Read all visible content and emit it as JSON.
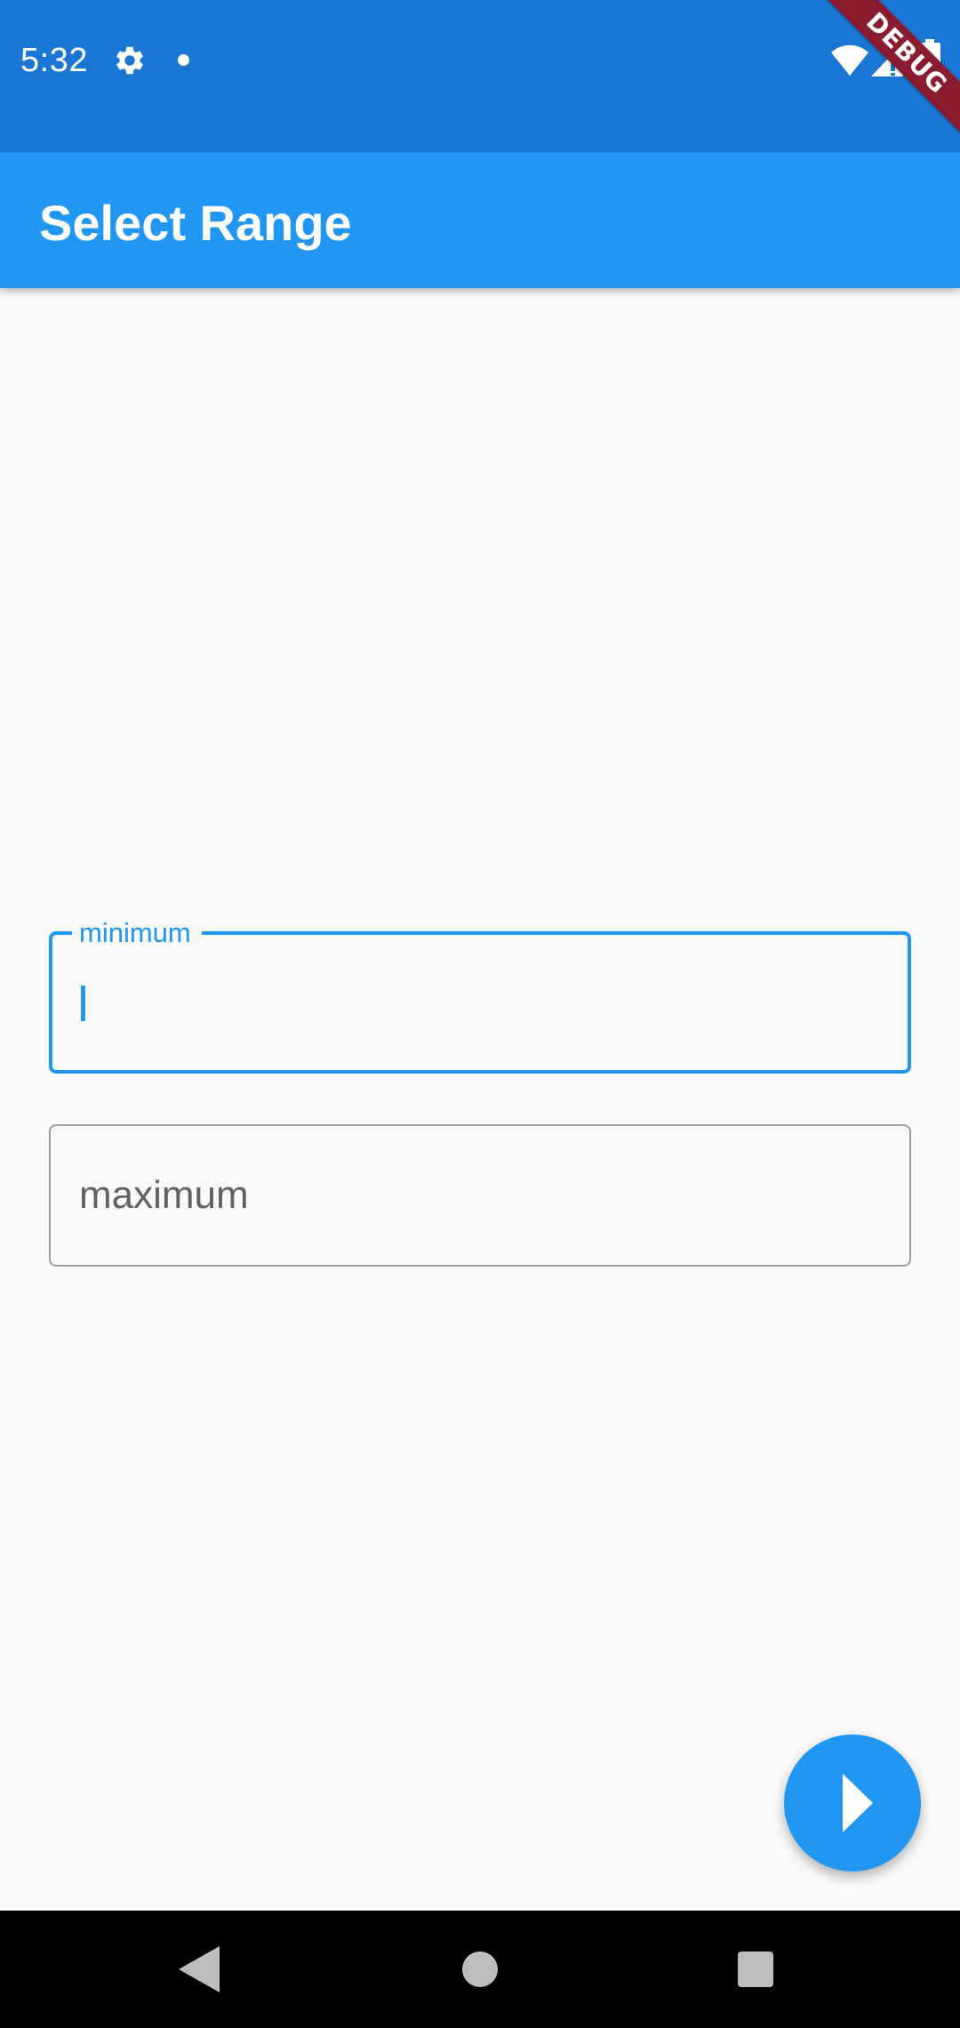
{
  "status_bar": {
    "time": "5:32",
    "icons": [
      "gear-icon",
      "notification-dot-icon",
      "wifi-icon",
      "signal-icon",
      "battery-icon"
    ],
    "color": "#1976d2"
  },
  "debug_banner": {
    "label": "DEBUG",
    "color": "#8b1c30"
  },
  "app_bar": {
    "title": "Select Range",
    "color": "#2196f3"
  },
  "form": {
    "minimum": {
      "label": "minimum",
      "value": "",
      "focused": true,
      "accent_color": "#2196f3"
    },
    "maximum": {
      "placeholder": "maximum",
      "value": "",
      "focused": false,
      "border_color": "#9e9e9e"
    }
  },
  "fab": {
    "icon": "play-arrow-icon",
    "color": "#2196f3"
  },
  "nav_bar": {
    "buttons": [
      "back-icon",
      "home-icon",
      "recents-icon"
    ]
  }
}
